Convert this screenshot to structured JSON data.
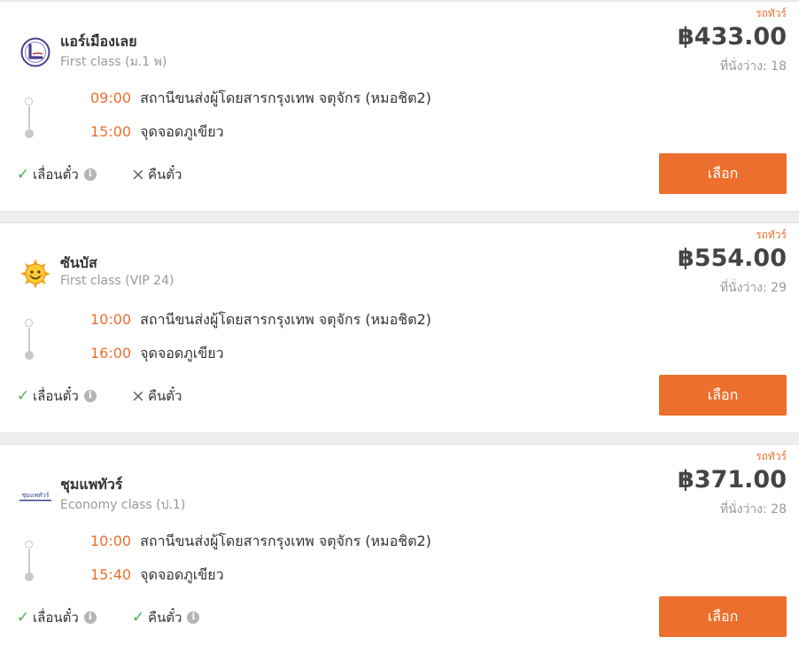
{
  "colors": {
    "accent": "#ec6f2d",
    "check": "#4caf50",
    "muted": "#999999",
    "text": "#333333"
  },
  "results": [
    {
      "operator": "แอร์เมืองเลย",
      "logo": "airmuangloei-logo",
      "class": "First class (ม.1 พ)",
      "tag": "รถทัวร์",
      "price": "฿433.00",
      "seats": "ที่นั่งว่าง: 18",
      "departure": {
        "time": "09:00",
        "place": "สถานีขนส่งผู้โดยสารกรุงเทพ จตุจักร (หมอชิต2)"
      },
      "arrival": {
        "time": "15:00",
        "place": "จุดจอดภูเขียว"
      },
      "features": [
        {
          "label": "เลื่อนตั๋ว",
          "available": true,
          "info": true
        },
        {
          "label": "คืนตั๋ว",
          "available": false,
          "info": false
        }
      ],
      "button": "เลือก"
    },
    {
      "operator": "ซันบัส",
      "logo": "sunbus-sun-logo",
      "class": "First class (VIP 24)",
      "tag": "รถทัวร์",
      "price": "฿554.00",
      "seats": "ที่นั่งว่าง: 29",
      "departure": {
        "time": "10:00",
        "place": "สถานีขนส่งผู้โดยสารกรุงเทพ จตุจักร (หมอชิต2)"
      },
      "arrival": {
        "time": "16:00",
        "place": "จุดจอดภูเขียว"
      },
      "features": [
        {
          "label": "เลื่อนตั๋ว",
          "available": true,
          "info": true
        },
        {
          "label": "คืนตั๋ว",
          "available": false,
          "info": false
        }
      ],
      "button": "เลือก"
    },
    {
      "operator": "ชุมแพทัวร์",
      "logo": "chumphae-tour-logo",
      "logo_text": "ชุมแพทัวร์",
      "class": "Economy class (ป.1)",
      "tag": "รถทัวร์",
      "price": "฿371.00",
      "seats": "ที่นั่งว่าง: 28",
      "departure": {
        "time": "10:00",
        "place": "สถานีขนส่งผู้โดยสารกรุงเทพ จตุจักร (หมอชิต2)"
      },
      "arrival": {
        "time": "15:40",
        "place": "จุดจอดภูเขียว"
      },
      "features": [
        {
          "label": "เลื่อนตั๋ว",
          "available": true,
          "info": true
        },
        {
          "label": "คืนตั๋ว",
          "available": true,
          "info": true
        }
      ],
      "button": "เลือก"
    }
  ]
}
